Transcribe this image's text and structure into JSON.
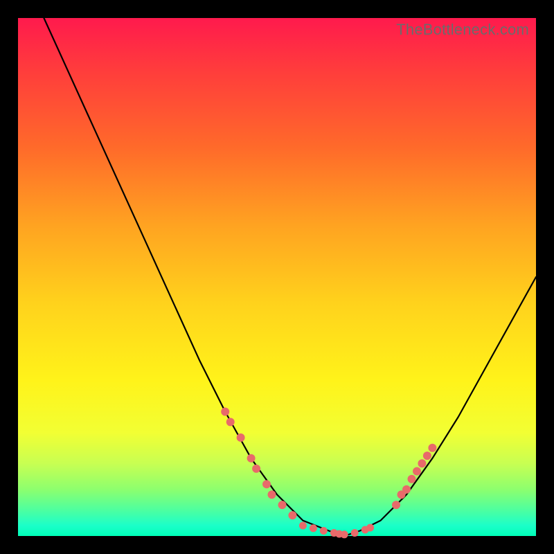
{
  "watermark": "TheBottleneck.com",
  "chart_data": {
    "type": "line",
    "title": "",
    "xlabel": "",
    "ylabel": "",
    "xlim": [
      0,
      100
    ],
    "ylim": [
      0,
      100
    ],
    "series": [
      {
        "name": "curve",
        "x": [
          5,
          10,
          15,
          20,
          25,
          30,
          35,
          40,
          45,
          50,
          55,
          60,
          63,
          66,
          70,
          75,
          80,
          85,
          90,
          95,
          100
        ],
        "values": [
          100,
          89,
          78,
          67,
          56,
          45,
          34,
          24,
          15,
          8,
          3,
          1,
          0,
          1,
          3,
          8,
          15,
          23,
          32,
          41,
          50
        ]
      }
    ],
    "points_left": [
      {
        "x": 40,
        "y": 24
      },
      {
        "x": 41,
        "y": 22
      },
      {
        "x": 43,
        "y": 19
      },
      {
        "x": 45,
        "y": 15
      },
      {
        "x": 46,
        "y": 13
      },
      {
        "x": 48,
        "y": 10
      },
      {
        "x": 49,
        "y": 8
      },
      {
        "x": 51,
        "y": 6
      },
      {
        "x": 53,
        "y": 4
      }
    ],
    "points_bottom": [
      {
        "x": 55,
        "y": 2
      },
      {
        "x": 57,
        "y": 1.5
      },
      {
        "x": 59,
        "y": 1
      },
      {
        "x": 61,
        "y": 0.6
      },
      {
        "x": 62,
        "y": 0.4
      },
      {
        "x": 63,
        "y": 0.3
      },
      {
        "x": 65,
        "y": 0.6
      },
      {
        "x": 67,
        "y": 1.2
      },
      {
        "x": 68,
        "y": 1.6
      }
    ],
    "points_right": [
      {
        "x": 73,
        "y": 6
      },
      {
        "x": 74,
        "y": 8
      },
      {
        "x": 75,
        "y": 9
      },
      {
        "x": 76,
        "y": 11
      },
      {
        "x": 77,
        "y": 12.5
      },
      {
        "x": 78,
        "y": 14
      },
      {
        "x": 79,
        "y": 15.5
      },
      {
        "x": 80,
        "y": 17
      }
    ]
  }
}
